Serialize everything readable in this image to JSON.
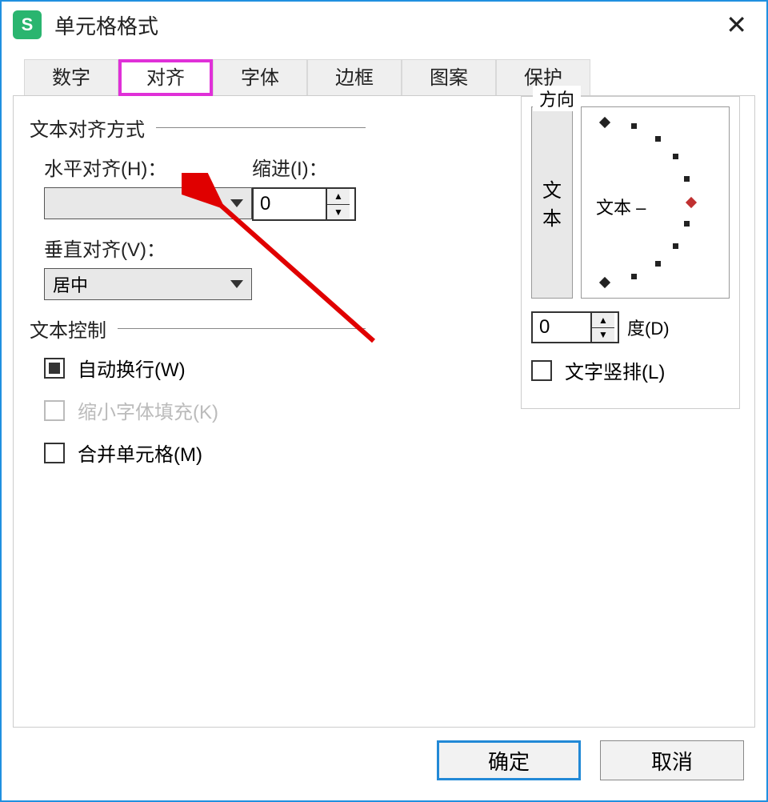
{
  "window": {
    "title": "单元格格式"
  },
  "tabs": {
    "number": "数字",
    "alignment": "对齐",
    "font": "字体",
    "border": "边框",
    "pattern": "图案",
    "protect": "保护"
  },
  "text_align": {
    "group": "文本对齐方式",
    "h_label": "水平对齐(H)：",
    "h_value": "",
    "indent_label": "缩进(I)：",
    "indent_value": "0",
    "v_label": "垂直对齐(V)：",
    "v_value": "居中"
  },
  "text_control": {
    "group": "文本控制",
    "wrap": "自动换行(W)",
    "shrink": "缩小字体填充(K)",
    "merge": "合并单元格(M)"
  },
  "orientation": {
    "group": "方向",
    "vbtn_1": "文",
    "vbtn_2": "本",
    "arc_label": "文本",
    "degree_value": "0",
    "degree_label": "度(D)",
    "vertical_cb": "文字竖排(L)"
  },
  "buttons": {
    "ok": "确定",
    "cancel": "取消"
  }
}
